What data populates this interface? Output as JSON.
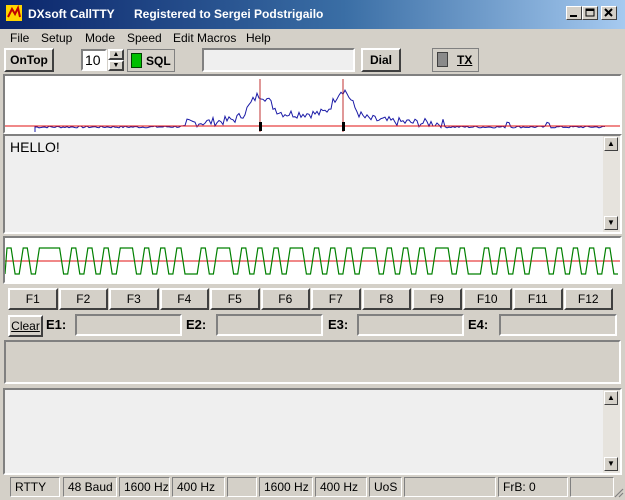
{
  "window": {
    "app_name": "DXsoft CallTTY",
    "registration": "Registered to Sergei Podstrigailo"
  },
  "menu": [
    "File",
    "Setup",
    "Mode",
    "Speed",
    "Edit Macros",
    "Help"
  ],
  "toolbar": {
    "ontop_label": "OnTop",
    "squelch_value": "10",
    "sql_label": "SQL",
    "dial_label": "Dial",
    "tx_label": "TX"
  },
  "receive": {
    "text": "HELLO!"
  },
  "function_keys": [
    "F1",
    "F2",
    "F3",
    "F4",
    "F5",
    "F6",
    "F7",
    "F8",
    "F9",
    "F10",
    "F11",
    "F12"
  ],
  "edit_row": {
    "clear_label": "Clear",
    "labels": [
      "E1:",
      "E2:",
      "E3:",
      "E4:"
    ]
  },
  "status_bar": [
    "RTTY",
    "48 Baud",
    "1600 Hz",
    "400 Hz",
    "",
    "1600 Hz",
    "400 Hz",
    "UoS",
    "",
    "FrB: 0",
    ""
  ],
  "colors": {
    "spectrum_line": "#1a1aa6",
    "marker_red": "#e01010",
    "tuning_green": "#008000",
    "sql_indicator": "#00c000"
  }
}
